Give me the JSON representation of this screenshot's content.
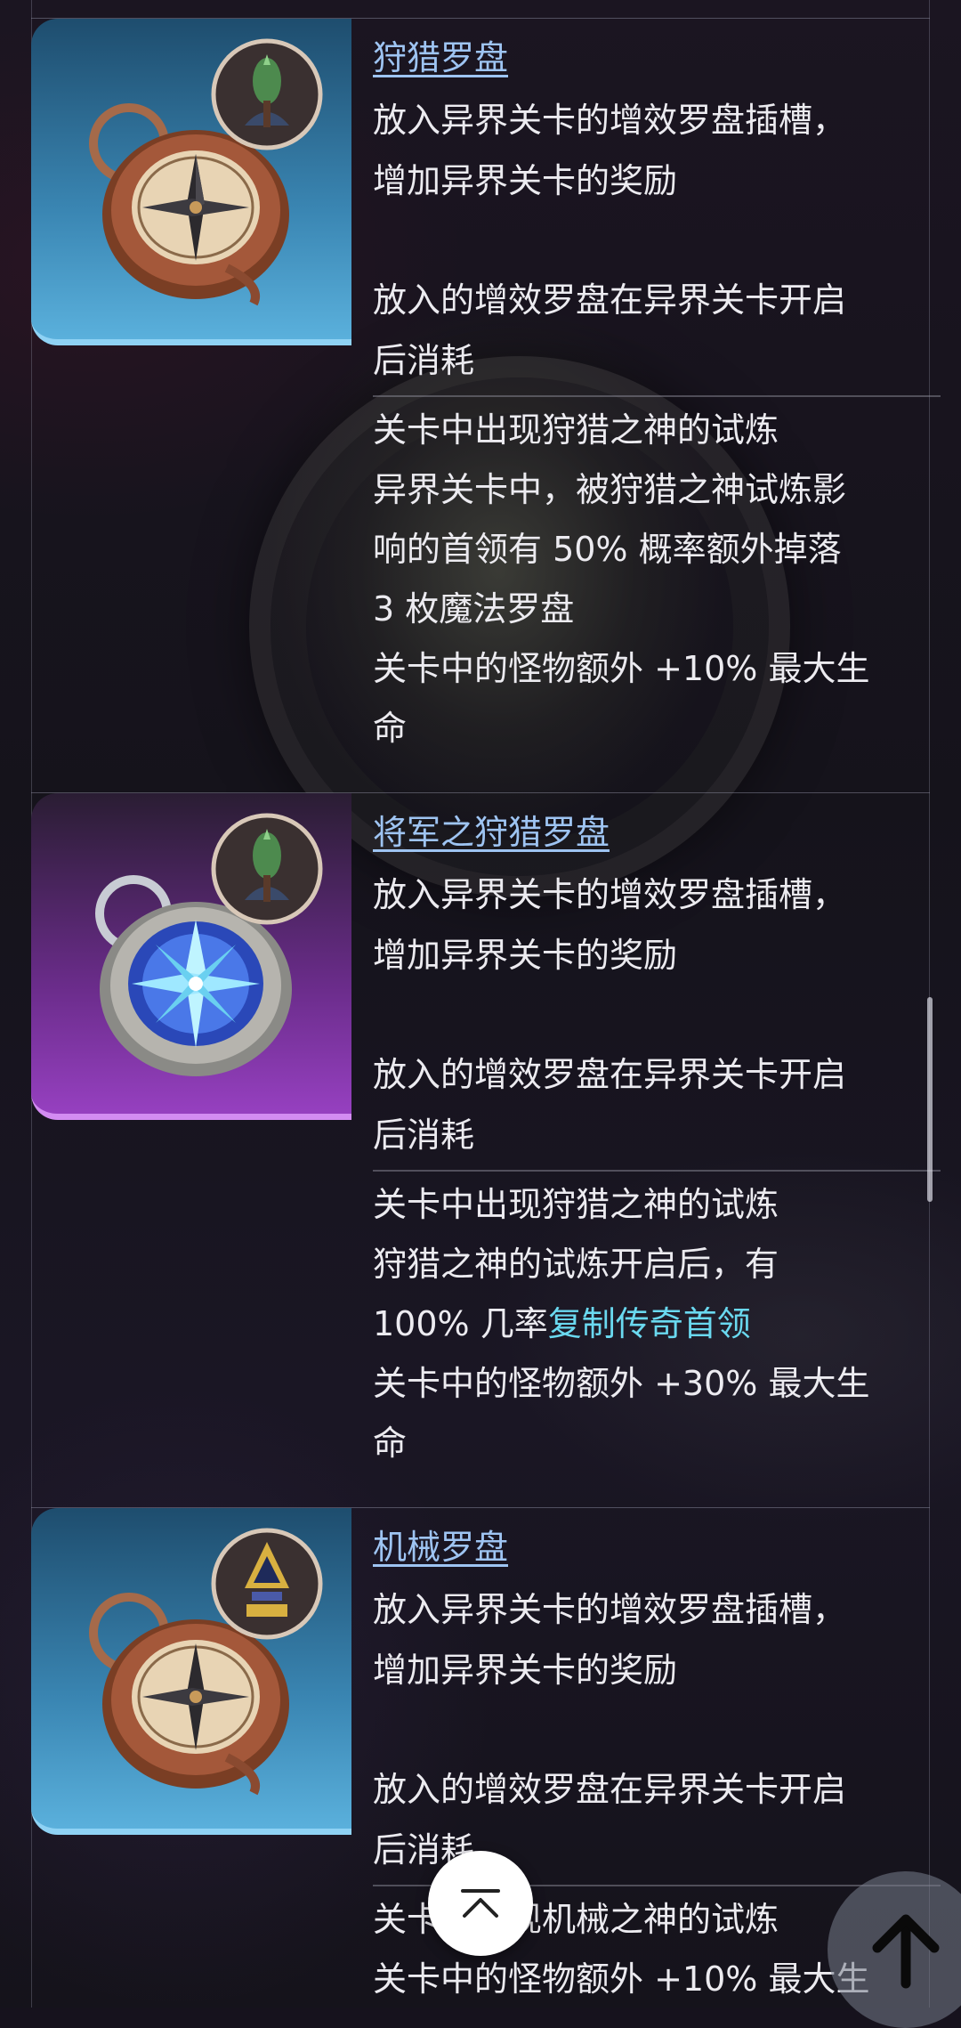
{
  "cards": [
    {
      "title": "狩猎罗盘",
      "theme": "blue",
      "desc_lines": [
        "放入异界关卡的增效罗盘插槽，",
        "增加异界关卡的奖励"
      ],
      "consume_lines": [
        "放入的增效罗盘在异界关卡开启",
        "后消耗"
      ],
      "effect_lines": [
        "关卡中出现狩猎之神的试炼",
        "异界关卡中，被狩猎之神试炼影",
        "响的首领有 50% 概率额外掉落",
        "3 枚魔法罗盘",
        "关卡中的怪物额外 +10% 最大生",
        "命"
      ]
    },
    {
      "title": "将军之狩猎罗盘",
      "theme": "purple",
      "desc_lines": [
        "放入异界关卡的增效罗盘插槽，",
        "增加异界关卡的奖励"
      ],
      "consume_lines": [
        "放入的增效罗盘在异界关卡开启",
        "后消耗"
      ],
      "effect_lines": [
        "关卡中出现狩猎之神的试炼",
        "狩猎之神的试炼开启后，有",
        "100% 几率",
        "复制传奇首领",
        "关卡中的怪物额外 +30% 最大生",
        "命"
      ]
    },
    {
      "title": "机械罗盘",
      "theme": "blue",
      "desc_lines": [
        "放入异界关卡的增效罗盘插槽，",
        "增加异界关卡的奖励"
      ],
      "consume_lines": [
        "放入的增效罗盘在异界关卡开启",
        "后消耗"
      ],
      "effect_lines": [
        "关卡中出现机械之神的试炼",
        "关卡中的怪物额外 +10% 最大生"
      ]
    }
  ],
  "colors": {
    "title_link": "#9ec4f2",
    "highlight": "#6ad9f0",
    "blue_card": "#3a86b3",
    "purple_card": "#9640c0"
  },
  "icons": {
    "scroll_top": "chevron-up-icon",
    "fab": "arrow-up-icon"
  }
}
